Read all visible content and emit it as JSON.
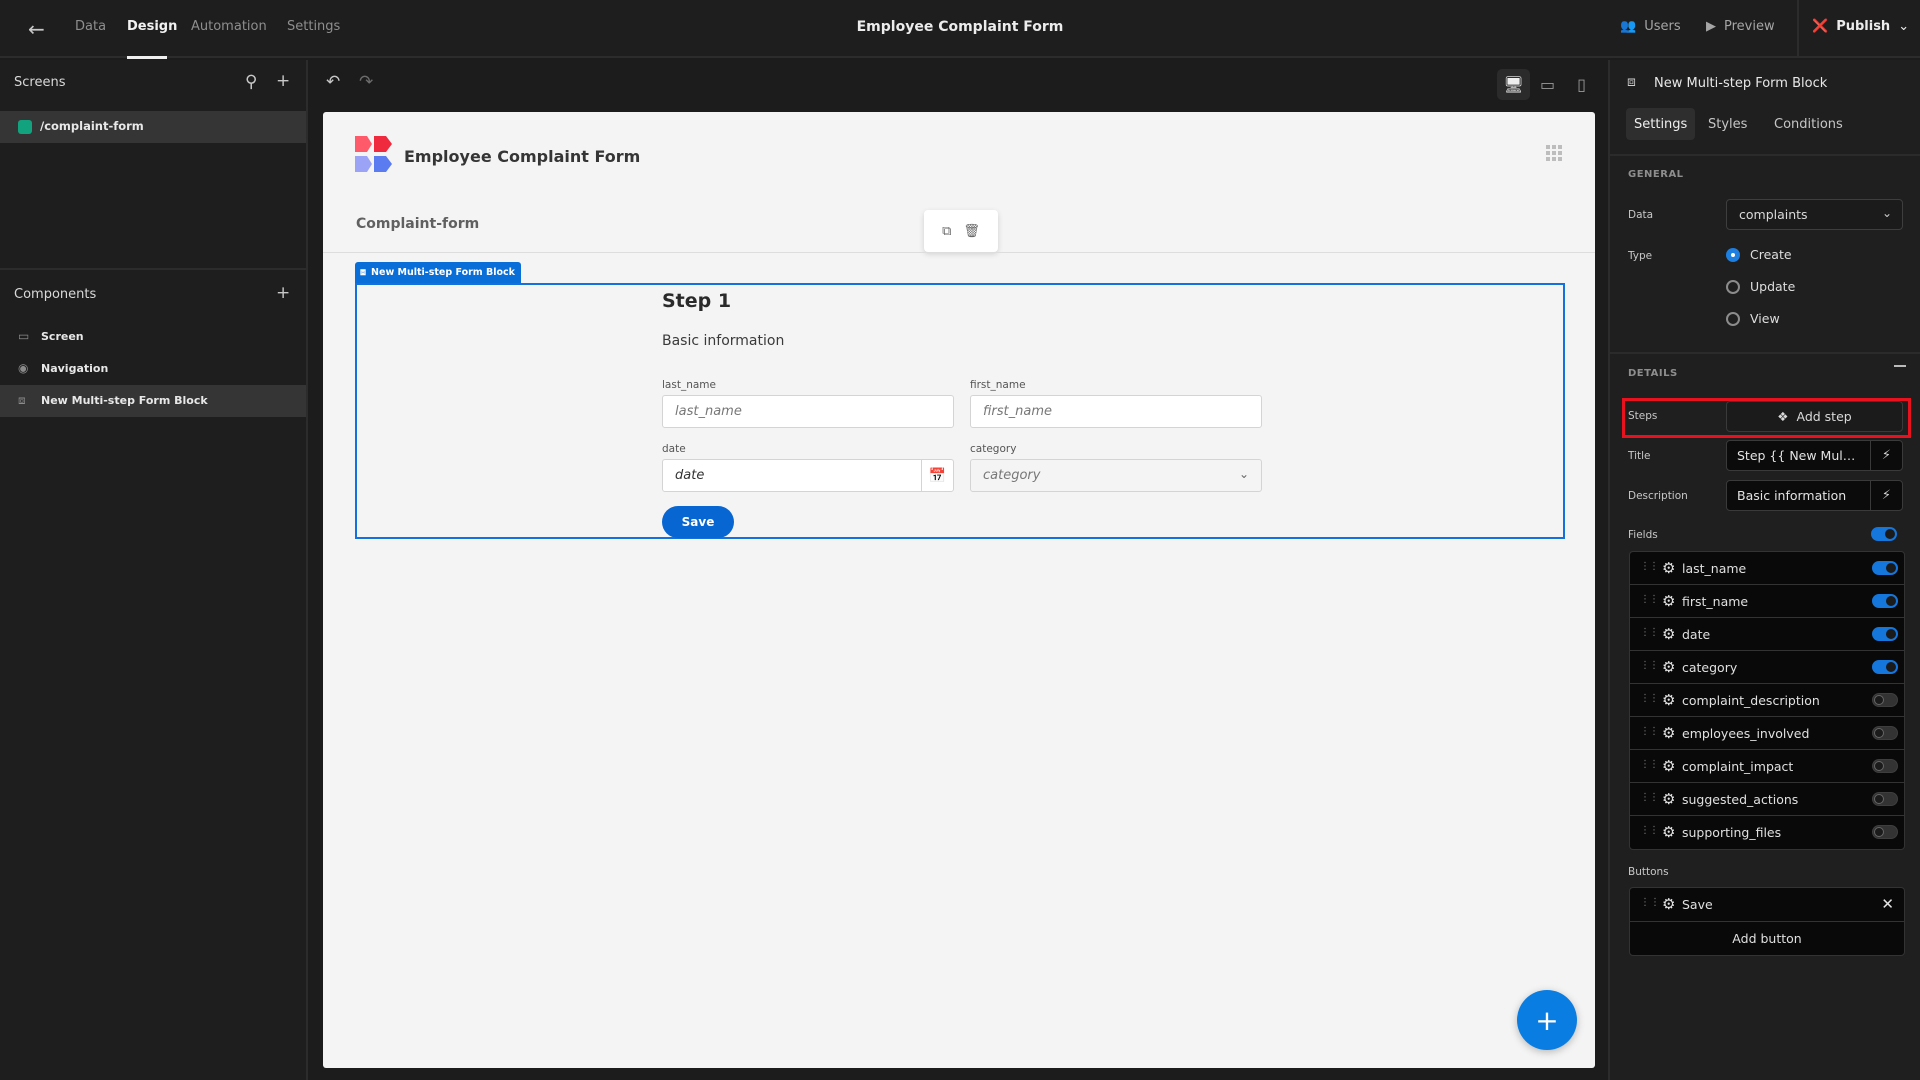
{
  "topbar": {
    "nav_tabs": [
      {
        "label": "Data",
        "active": false
      },
      {
        "label": "Design",
        "active": true
      },
      {
        "label": "Automation",
        "active": false
      },
      {
        "label": "Settings",
        "active": false
      }
    ],
    "app_title": "Employee Complaint Form",
    "users_label": "Users",
    "preview_label": "Preview",
    "publish_label": "Publish"
  },
  "left_panel": {
    "screens_title": "Screens",
    "screens": [
      {
        "route": "/complaint-form",
        "color": "#12a37e"
      }
    ],
    "components_title": "Components",
    "components": [
      {
        "label": "Screen",
        "icon": "screen-icon"
      },
      {
        "label": "Navigation",
        "icon": "eye-icon"
      },
      {
        "label": "New Multi-step Form Block",
        "icon": "form-block-icon",
        "selected": true
      }
    ]
  },
  "canvas": {
    "title": "Employee Complaint Form",
    "subtitle": "Complaint-form",
    "block_tag": "New Multi-step Form Block",
    "step_title": "Step 1",
    "step_description": "Basic information",
    "fields": [
      {
        "label": "last_name",
        "placeholder": "last_name",
        "type": "text"
      },
      {
        "label": "first_name",
        "placeholder": "first_name",
        "type": "text"
      },
      {
        "label": "date",
        "placeholder": "date",
        "type": "date"
      },
      {
        "label": "category",
        "placeholder": "category",
        "type": "select"
      }
    ],
    "save_label": "Save",
    "fab_label": "+"
  },
  "right_panel": {
    "component_title": "New Multi-step Form Block",
    "tabs": [
      {
        "label": "Settings",
        "active": true
      },
      {
        "label": "Styles",
        "active": false
      },
      {
        "label": "Conditions",
        "active": false
      }
    ],
    "general": {
      "section_title": "GENERAL",
      "data_label": "Data",
      "data_value": "complaints",
      "type_label": "Type",
      "type_options": [
        {
          "label": "Create",
          "selected": true
        },
        {
          "label": "Update",
          "selected": false
        },
        {
          "label": "View",
          "selected": false
        }
      ]
    },
    "details": {
      "section_title": "DETAILS",
      "steps_label": "Steps",
      "add_step_label": "Add step",
      "title_label": "Title",
      "title_value": "Step {{ New Multi-step Form Block.Step }}",
      "description_label": "Description",
      "description_value": "Basic information",
      "fields_label": "Fields",
      "fields_all_on": true,
      "fields": [
        {
          "name": "last_name",
          "enabled": true
        },
        {
          "name": "first_name",
          "enabled": true
        },
        {
          "name": "date",
          "enabled": true
        },
        {
          "name": "category",
          "enabled": true
        },
        {
          "name": "complaint_description",
          "enabled": false
        },
        {
          "name": "employees_involved",
          "enabled": false
        },
        {
          "name": "complaint_impact",
          "enabled": false
        },
        {
          "name": "suggested_actions",
          "enabled": false
        },
        {
          "name": "supporting_files",
          "enabled": false
        }
      ],
      "buttons_label": "Buttons",
      "buttons": [
        {
          "label": "Save"
        }
      ],
      "add_button_label": "Add button"
    }
  },
  "colors": {
    "accent": "#0a7de2",
    "highlight": "#e8121f",
    "screen_dot": "#12a37e"
  }
}
